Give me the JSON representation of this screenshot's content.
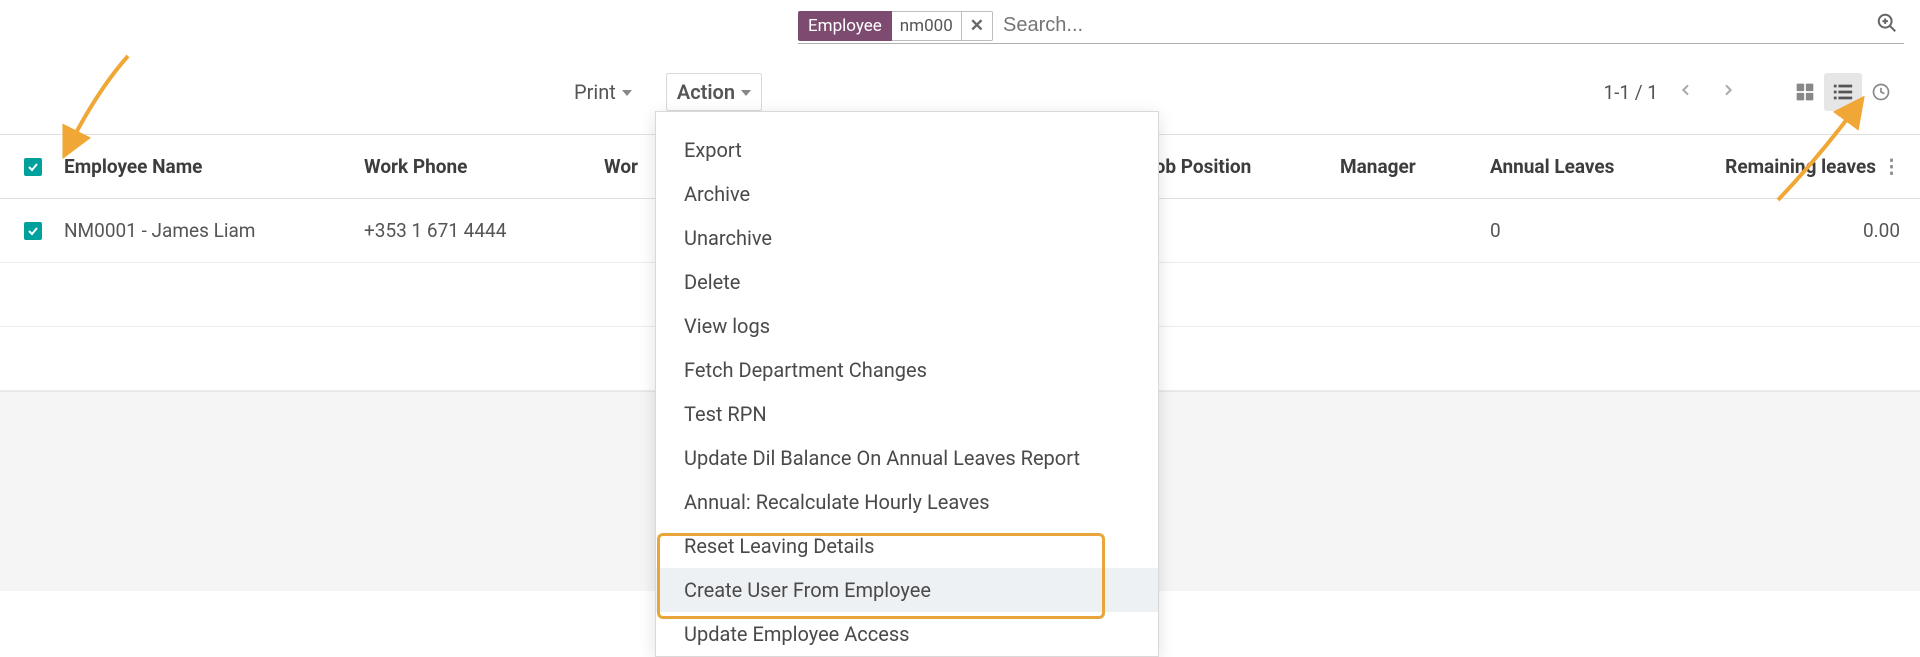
{
  "search": {
    "facet_label": "Employee",
    "facet_value": "nm000",
    "placeholder": "Search..."
  },
  "toolbar": {
    "print_label": "Print",
    "action_label": "Action",
    "pager_text": "1-1 / 1"
  },
  "action_menu": {
    "items": [
      "Export",
      "Archive",
      "Unarchive",
      "Delete",
      "View logs",
      "Fetch Department Changes",
      "Test RPN",
      "Update Dil Balance On Annual Leaves Report",
      "Annual: Recalculate Hourly Leaves",
      "Reset Leaving Details",
      "Create User From Employee",
      "Update Employee Access"
    ]
  },
  "table": {
    "headers": {
      "name": "Employee Name",
      "phone": "Work Phone",
      "wor": "Wor",
      "job": "Job Position",
      "manager": "Manager",
      "annual": "Annual Leaves",
      "remaining": "Remaining leaves"
    },
    "rows": [
      {
        "name": "NM0001 - James Liam",
        "phone": "+353 1 671 4444",
        "job": "",
        "manager": "",
        "annual": "0",
        "remaining": "0.00"
      }
    ]
  }
}
